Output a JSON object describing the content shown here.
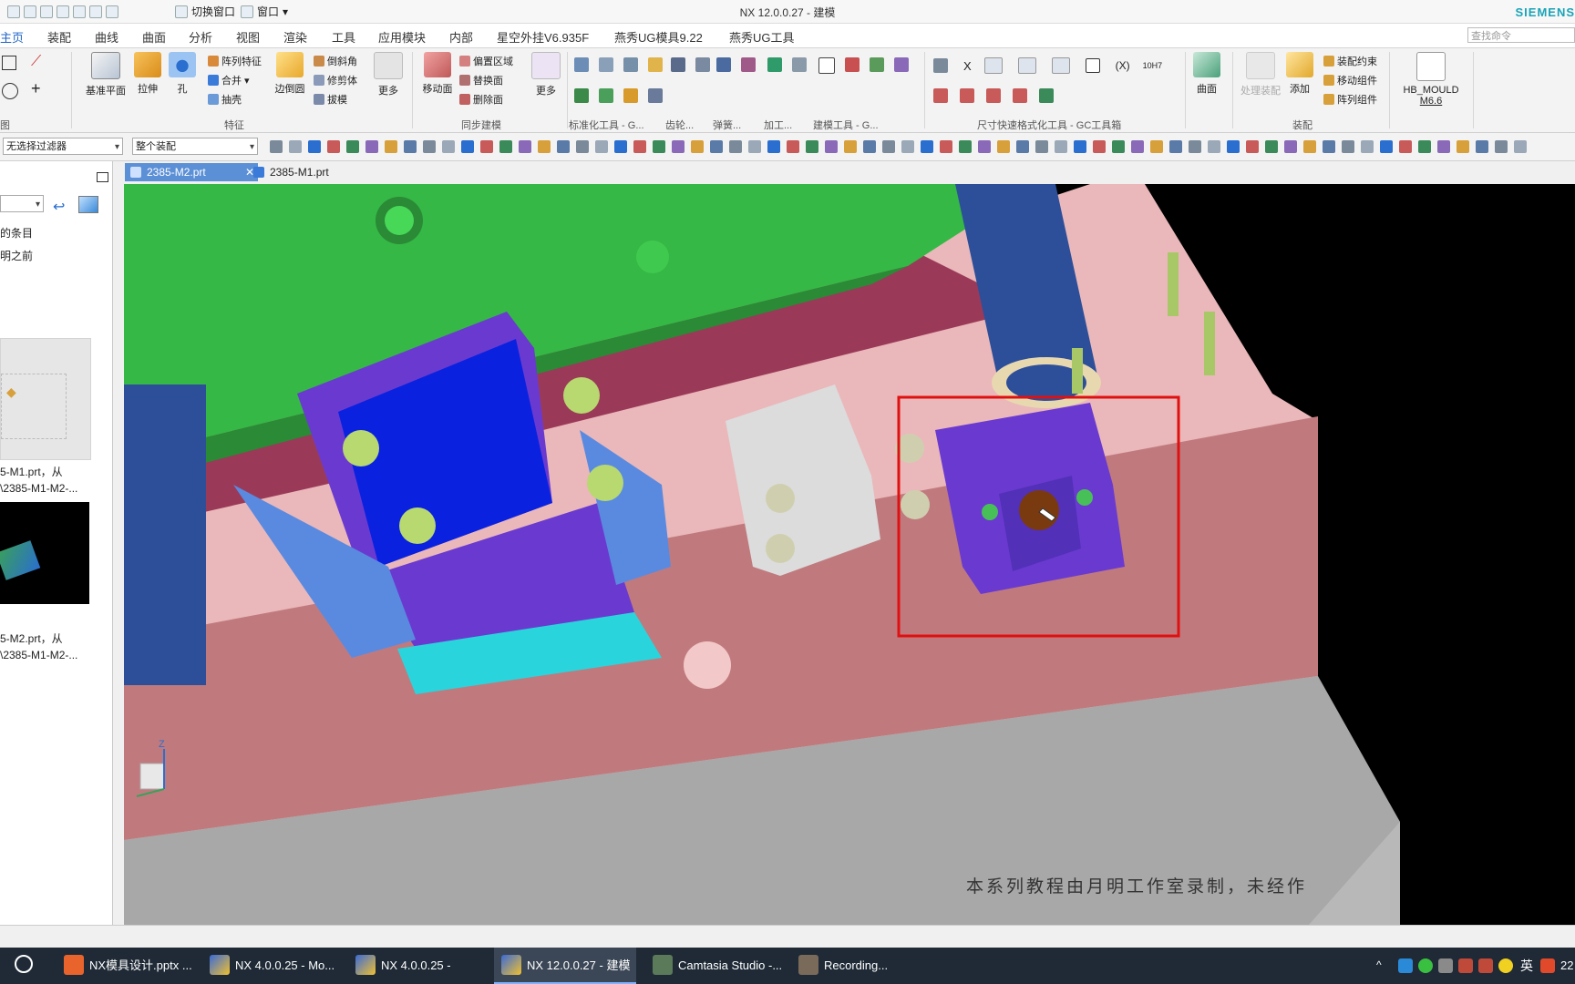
{
  "window": {
    "title": "NX 12.0.0.27 - 建模",
    "brand": "SIEMENS",
    "quick_access": [
      "切换窗口",
      "窗口"
    ]
  },
  "menu": {
    "tabs": [
      "主页",
      "装配",
      "曲线",
      "曲面",
      "分析",
      "视图",
      "渲染",
      "工具",
      "应用模块",
      "内部",
      "星空外挂V6.935F",
      "燕秀UG模具9.22",
      "燕秀UG工具"
    ],
    "active": "主页",
    "search_placeholder": "查找命令"
  },
  "ribbon": {
    "big_buttons": {
      "datum_plane": "基准平面",
      "extrude": "拉伸",
      "hole": "孔",
      "edge_blend": "边倒圆",
      "more1": "更多",
      "move_face": "移动面",
      "more2": "更多",
      "surface": "曲面",
      "add": "添加",
      "hb_mould": "HB_MOULD",
      "hb_version": "M6.6",
      "process_assembly": "处理装配"
    },
    "small_buttons": {
      "pattern_feature": "阵列特征",
      "combine": "合并",
      "shell": "抽壳",
      "chamfer": "倒斜角",
      "trim_body": "修剪体",
      "draft": "拔模",
      "offset_region": "偏置区域",
      "replace_face": "替换面",
      "delete_face": "删除面",
      "assembly_constraints": "装配约束",
      "move_component": "移动组件",
      "pattern_component": "阵列组件"
    },
    "groups": {
      "feature": "特征",
      "sync_modeling": "同步建模",
      "std_tools": "标准化工具 - G...",
      "gear": "齿轮...",
      "spring": "弹簧...",
      "machining": "加工...",
      "modeling_tools": "建模工具 - G...",
      "dim_tools": "尺寸快速格式化工具 - GC工具箱",
      "assembly": "装配",
      "left_group_partial": "图"
    },
    "dim_labels": [
      "X",
      "(X)",
      "10H7"
    ]
  },
  "filterbar": {
    "selection_filter": "无选择过滤器",
    "assembly_scope": "整个装配"
  },
  "left_panel": {
    "line1": "的条目",
    "line2": "明之前",
    "files": [
      {
        "name": "5-M1.prt，从",
        "path": "\\2385-M1-M2-..."
      },
      {
        "name": "5-M2.prt，从",
        "path": "\\2385-M1-M2-..."
      }
    ]
  },
  "doc_tabs": [
    {
      "label": "2385-M2.prt",
      "active": true
    },
    {
      "label": "2385-M1.prt",
      "active": false
    }
  ],
  "viewport": {
    "watermark": "本系列教程由月明工作室录制，未经作",
    "axis_label": "Z",
    "highlight_color": "#e01010"
  },
  "taskbar": {
    "items": [
      {
        "label": "NX模具设计.pptx ...",
        "active": false
      },
      {
        "label": "NX 4.0.0.25 - Mo...",
        "active": false
      },
      {
        "label": "NX 4.0.0.25 -",
        "active": false
      },
      {
        "label": "NX 12.0.0.27 - 建模",
        "active": true
      },
      {
        "label": "Camtasia Studio -...",
        "active": false
      },
      {
        "label": "Recording...",
        "active": false
      }
    ],
    "ime": "英",
    "clock": "22"
  }
}
